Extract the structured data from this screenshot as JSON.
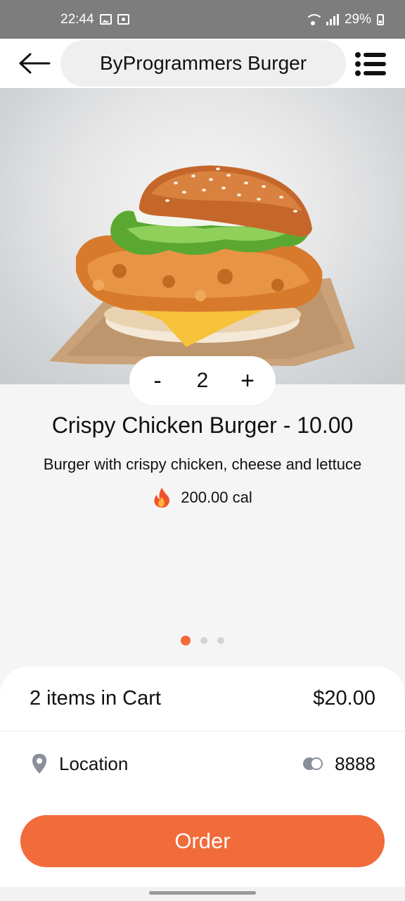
{
  "status_bar": {
    "time": "22:44",
    "battery": "29%"
  },
  "header": {
    "title": "ByProgrammers Burger"
  },
  "product": {
    "quantity": "2",
    "decrement_label": "-",
    "increment_label": "+",
    "title": "Crispy Chicken Burger - 10.00",
    "description": "Burger with crispy chicken, cheese and lettuce",
    "calories": "200.00 cal",
    "image_icon": "burger-photo"
  },
  "pagination": {
    "total": 3,
    "active_index": 0
  },
  "cart": {
    "summary": "2 items in Cart",
    "total": "$20.00",
    "location_label": "Location",
    "card_number": "8888"
  },
  "order_button": {
    "label": "Order"
  },
  "colors": {
    "accent": "#f26b3a",
    "background": "#f5f5f5",
    "status_bar": "#7d7d7d"
  }
}
